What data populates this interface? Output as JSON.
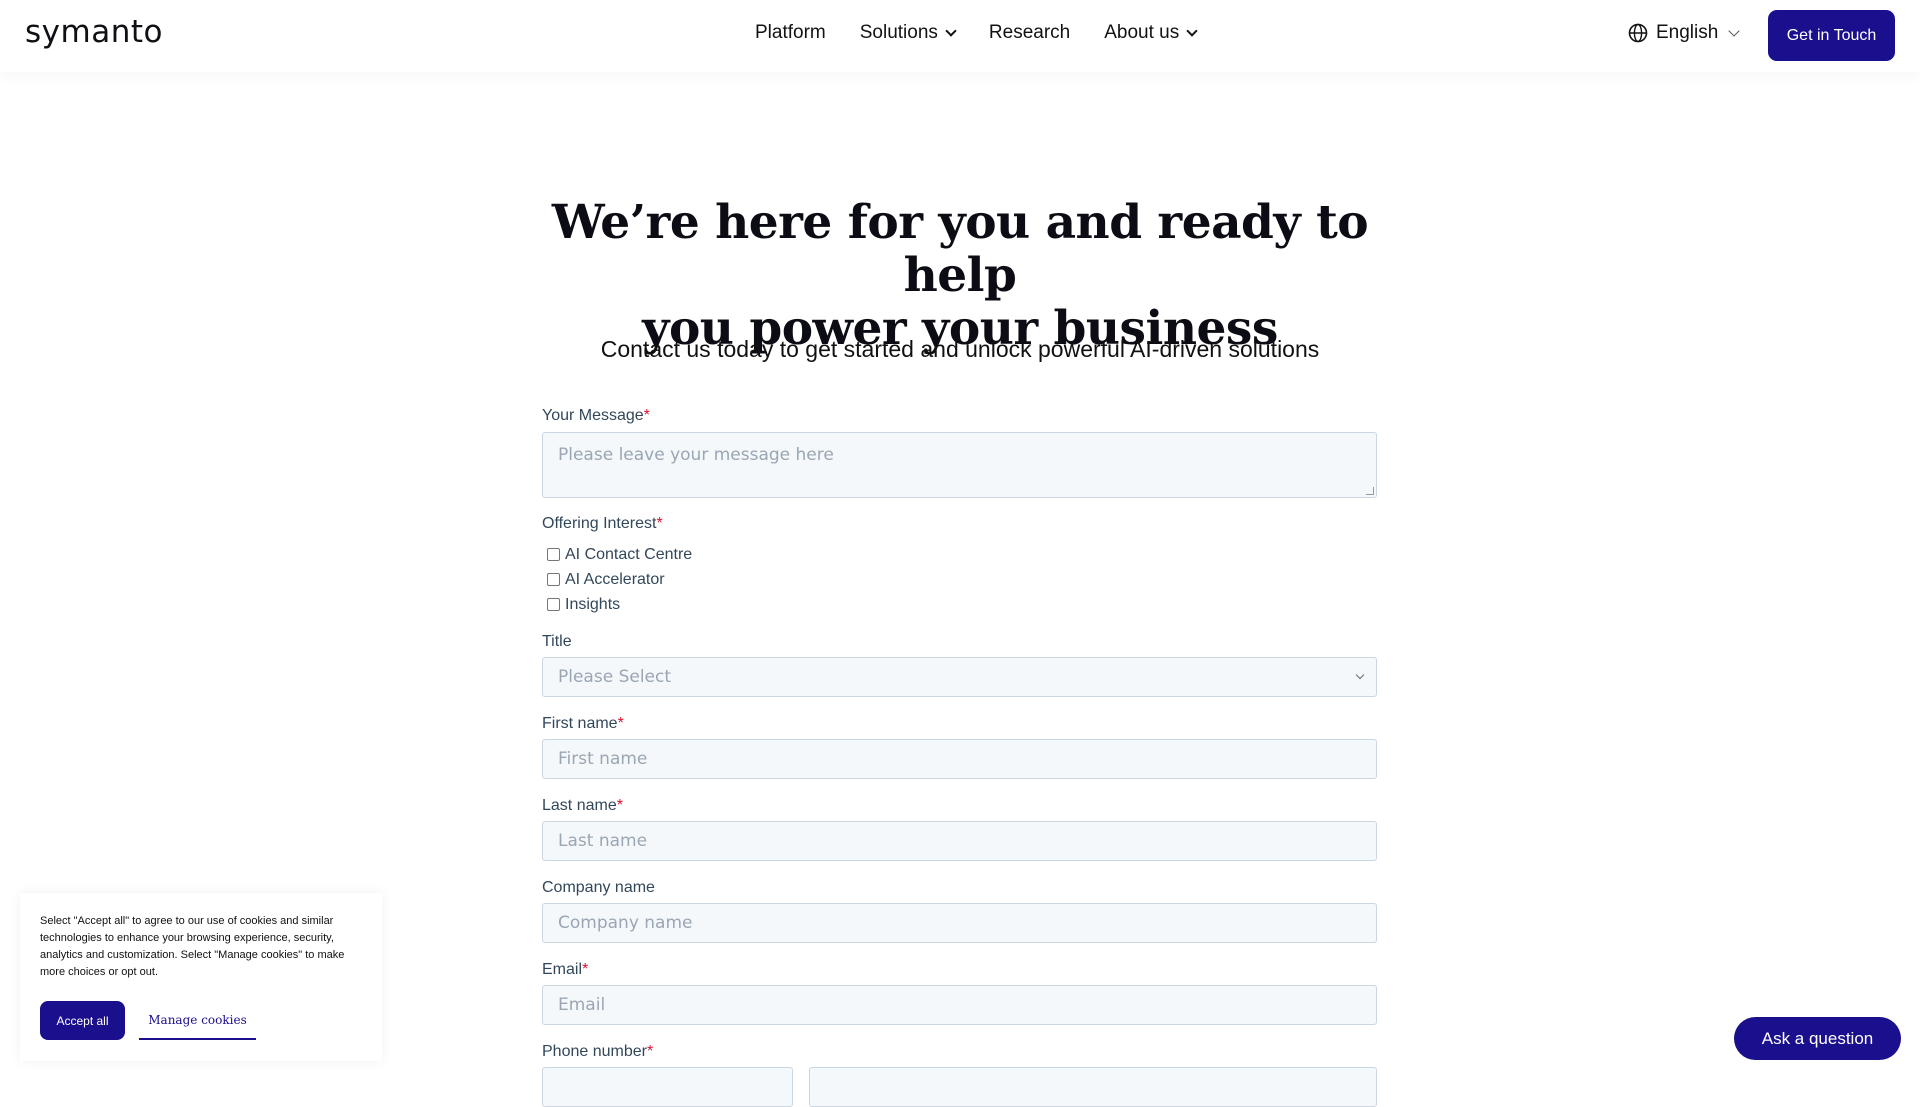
{
  "header": {
    "logo": "symanto",
    "nav": {
      "platform": "Platform",
      "solutions": "Solutions",
      "research": "Research",
      "about": "About us"
    },
    "language": "English",
    "cta": "Get in Touch"
  },
  "hero": {
    "title_line1": "We’re here for you and ready to help",
    "title_line2": "you power your business",
    "subtitle": "Contact us today to get started and unlock powerful AI-driven solutions"
  },
  "form": {
    "required_mark": "*",
    "message": {
      "label": "Your Message",
      "placeholder": "Please leave your message here"
    },
    "offering": {
      "label": "Offering Interest",
      "options": [
        "AI Contact Centre",
        "AI Accelerator",
        "Insights"
      ]
    },
    "title": {
      "label": "Title",
      "placeholder": "Please Select"
    },
    "first_name": {
      "label": "First name",
      "placeholder": "First name"
    },
    "last_name": {
      "label": "Last name",
      "placeholder": "Last name"
    },
    "company": {
      "label": "Company name",
      "placeholder": "Company name"
    },
    "email": {
      "label": "Email",
      "placeholder": "Email"
    },
    "phone": {
      "label": "Phone number"
    }
  },
  "cookie": {
    "text": "Select \"Accept all\" to agree to our use of cookies and similar technologies to enhance your browsing experience, security, analytics and customization. Select \"Manage cookies\" to make more choices or opt out.",
    "accept": "Accept all",
    "manage": "Manage cookies"
  },
  "chat": {
    "label": "Ask a question"
  },
  "colors": {
    "brand": "#1a0f8c",
    "required": "#e0102e",
    "input_bg": "#f5f8fa",
    "input_border": "#cbd6e2"
  },
  "icons": [
    "globe-icon",
    "chevron-down-icon"
  ]
}
